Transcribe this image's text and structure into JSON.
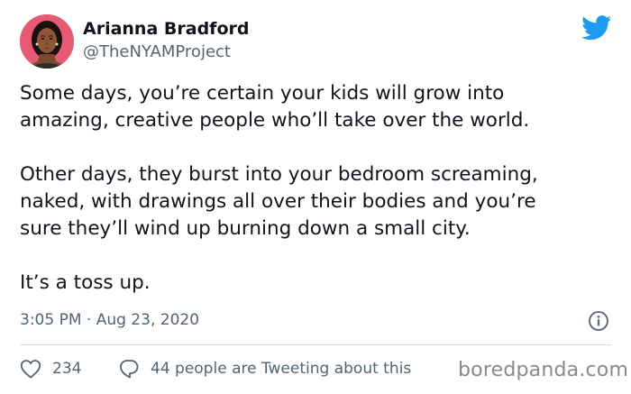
{
  "author": {
    "name": "Arianna Bradford",
    "handle": "@TheNYAMProject"
  },
  "tweet": {
    "paragraphs": [
      [
        "Some days, you’re certain your kids will grow into",
        "amazing, creative people who’ll take over the world."
      ],
      [
        "Other days, they burst into your bedroom screaming,",
        "naked, with drawings all over their bodies and you’re",
        "sure they’ll wind up burning down a small city."
      ],
      [
        "It’s a toss up."
      ]
    ],
    "timestamp": "3:05 PM · Aug 23, 2020"
  },
  "engagement": {
    "like_count": "234",
    "people_tweeting": "44 people are Tweeting about this"
  },
  "watermark": "boredpanda.com",
  "icons": {
    "brand": "twitter-bird-icon",
    "info": "info-icon",
    "like": "heart-icon",
    "reply": "speech-bubble-icon"
  },
  "colors": {
    "twitter_blue": "#1d9bf0",
    "secondary_text": "#536471",
    "avatar_background": "#e65a73"
  }
}
